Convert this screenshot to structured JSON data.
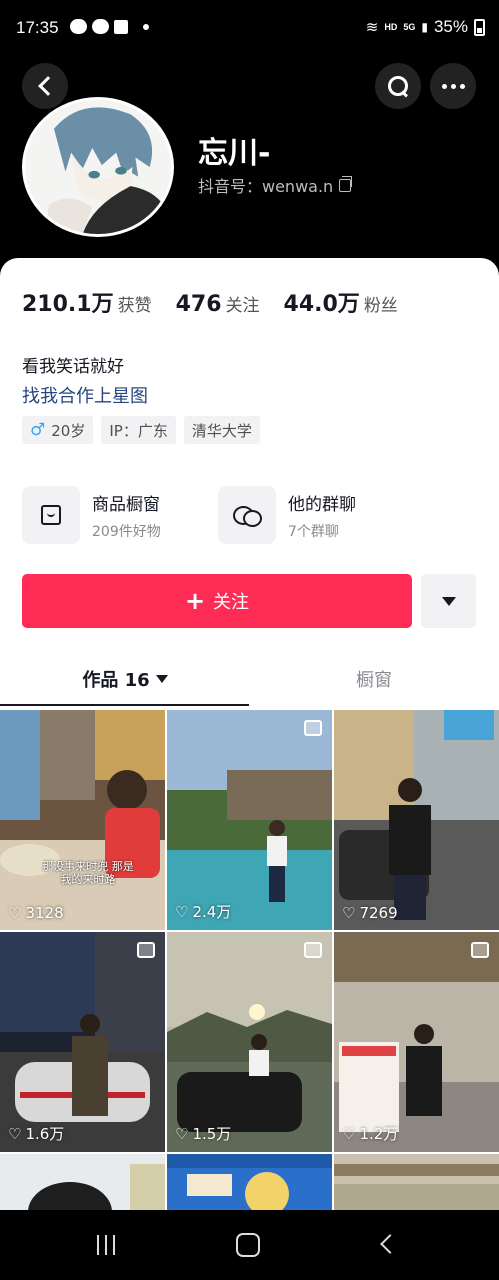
{
  "status_bar": {
    "time": "17:35",
    "network": "HD",
    "signal": "5G",
    "battery": "35%"
  },
  "header": {
    "nickname": "忘川-",
    "douyin_id": "抖音号：wenwa.n"
  },
  "stats": [
    {
      "value": "210.1万",
      "label": "获赞"
    },
    {
      "value": "476",
      "label": "关注"
    },
    {
      "value": "44.0万",
      "label": "粉丝"
    }
  ],
  "bio": {
    "text": "看我笑话就好",
    "link": "找我合作上星图"
  },
  "tags": {
    "gender_symbol": "♂",
    "age": "20岁",
    "ip": "IP：广东",
    "school": "清华大学"
  },
  "features": {
    "shop": {
      "title": "商品橱窗",
      "subtitle": "209件好物"
    },
    "group": {
      "title": "他的群聊",
      "subtitle": "7个群聊"
    }
  },
  "follow_button": {
    "label": "关注",
    "color": "#fe2c55"
  },
  "tabs": {
    "works": "作品 16",
    "window": "橱窗"
  },
  "videos": [
    {
      "likes": "3128",
      "caption": "那没事来时兜 那是我的来时路"
    },
    {
      "likes": "2.4万"
    },
    {
      "likes": "7269"
    },
    {
      "likes": "1.6万"
    },
    {
      "likes": "1.5万"
    },
    {
      "likes": "1.2万"
    }
  ],
  "icons": [
    "back-icon",
    "search-icon",
    "more-icon",
    "copy-icon",
    "bag-icon",
    "chat-icon",
    "heart-icon",
    "multi-image-icon"
  ]
}
